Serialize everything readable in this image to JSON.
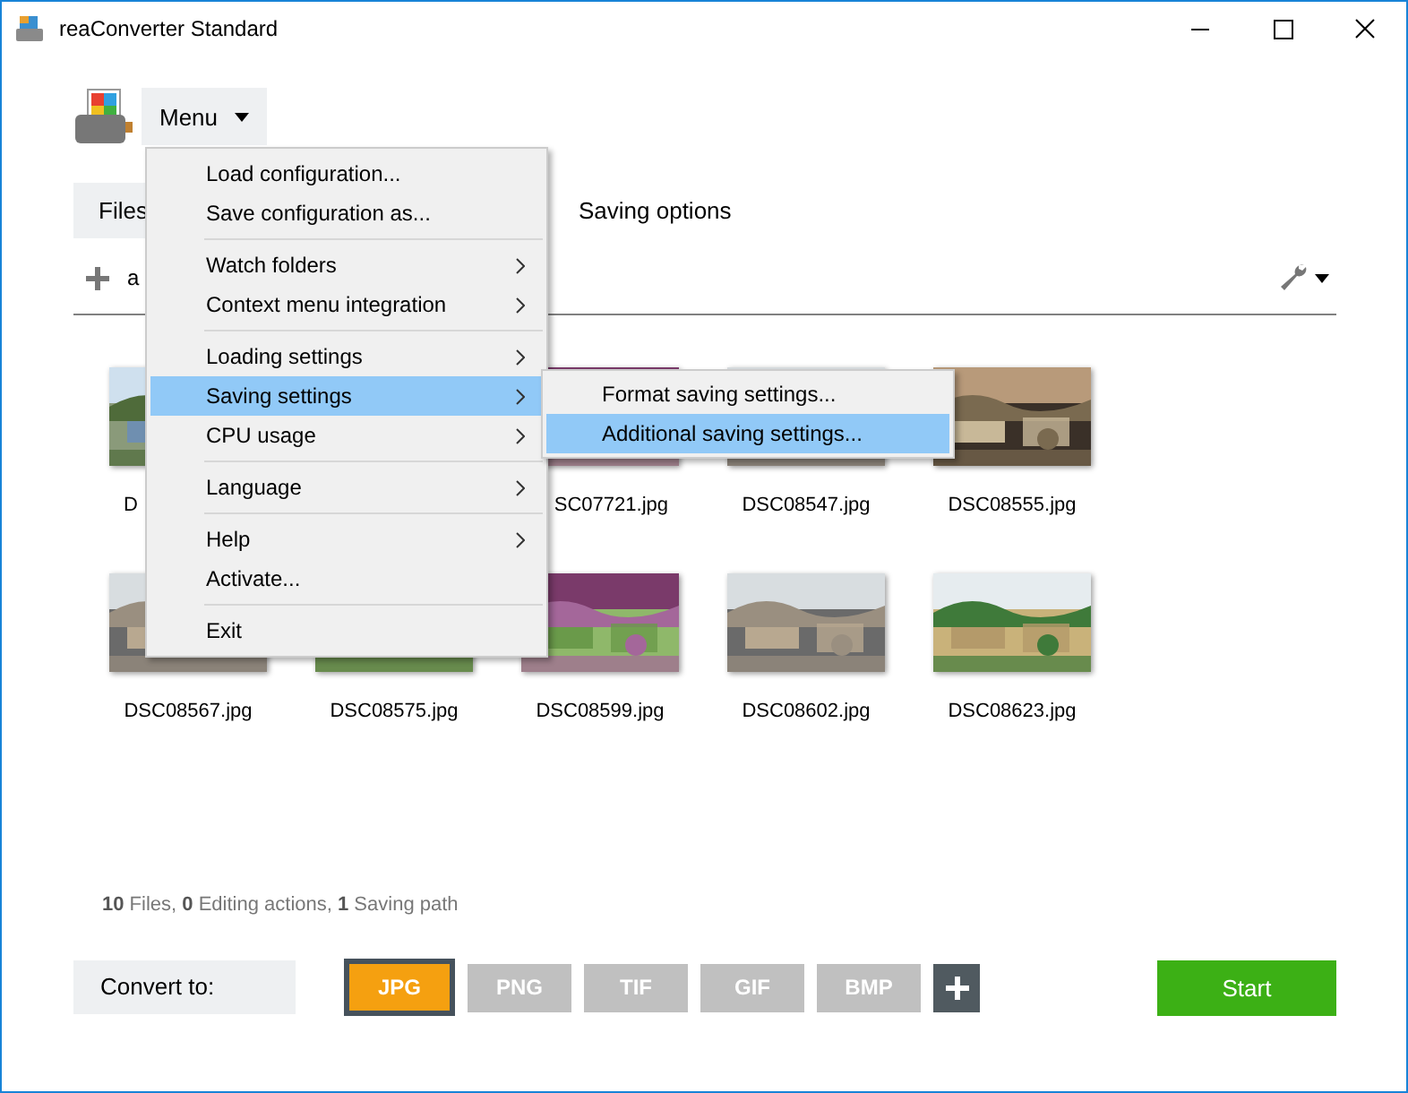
{
  "window": {
    "title": "reaConverter Standard"
  },
  "menu_button": {
    "label": "Menu"
  },
  "tabs": [
    {
      "label": "Files",
      "selected": true
    },
    {
      "label": "Saving options",
      "selected": false
    }
  ],
  "toolbar": {
    "add_label": "a"
  },
  "files": [
    {
      "label": "D",
      "kind": "lake",
      "clipped_right": true
    },
    {
      "label": "SC07721.jpg",
      "kind": "market",
      "clipped_left": true
    },
    {
      "label": "DSC08547.jpg",
      "kind": "street"
    },
    {
      "label": "DSC08555.jpg",
      "kind": "cow"
    },
    {
      "label": "DSC08567.jpg",
      "kind": "street"
    },
    {
      "label": "DSC08575.jpg",
      "kind": "field"
    },
    {
      "label": "DSC08599.jpg",
      "kind": "market"
    },
    {
      "label": "DSC08602.jpg",
      "kind": "street"
    },
    {
      "label": "DSC08623.jpg",
      "kind": "field"
    }
  ],
  "menu": [
    {
      "kind": "item",
      "label": "Load configuration...",
      "submenu": false,
      "selected": false
    },
    {
      "kind": "item",
      "label": "Save configuration as...",
      "submenu": false,
      "selected": false
    },
    {
      "kind": "separator"
    },
    {
      "kind": "item",
      "label": "Watch folders",
      "submenu": true,
      "selected": false
    },
    {
      "kind": "item",
      "label": "Context menu integration",
      "submenu": true,
      "selected": false
    },
    {
      "kind": "separator"
    },
    {
      "kind": "item",
      "label": "Loading settings",
      "submenu": true,
      "selected": false
    },
    {
      "kind": "item",
      "label": "Saving settings",
      "submenu": true,
      "selected": true
    },
    {
      "kind": "item",
      "label": "CPU usage",
      "submenu": true,
      "selected": false
    },
    {
      "kind": "separator"
    },
    {
      "kind": "item",
      "label": "Language",
      "submenu": true,
      "selected": false
    },
    {
      "kind": "separator"
    },
    {
      "kind": "item",
      "label": "Help",
      "submenu": true,
      "selected": false
    },
    {
      "kind": "item",
      "label": "Activate...",
      "submenu": false,
      "selected": false
    },
    {
      "kind": "separator"
    },
    {
      "kind": "item",
      "label": "Exit",
      "submenu": false,
      "selected": false
    }
  ],
  "submenu": [
    {
      "label": "Format saving settings...",
      "selected": false
    },
    {
      "label": "Additional saving settings...",
      "selected": true
    }
  ],
  "status": "**10** Files, **0** Editing actions, **1** Saving path",
  "convert_to": "Convert to:",
  "formats": [
    {
      "label": "JPG",
      "selected": true
    },
    {
      "label": "PNG",
      "selected": false
    },
    {
      "label": "TIF",
      "selected": false
    },
    {
      "label": "GIF",
      "selected": false
    },
    {
      "label": "BMP",
      "selected": false
    }
  ],
  "start_button": "Start"
}
